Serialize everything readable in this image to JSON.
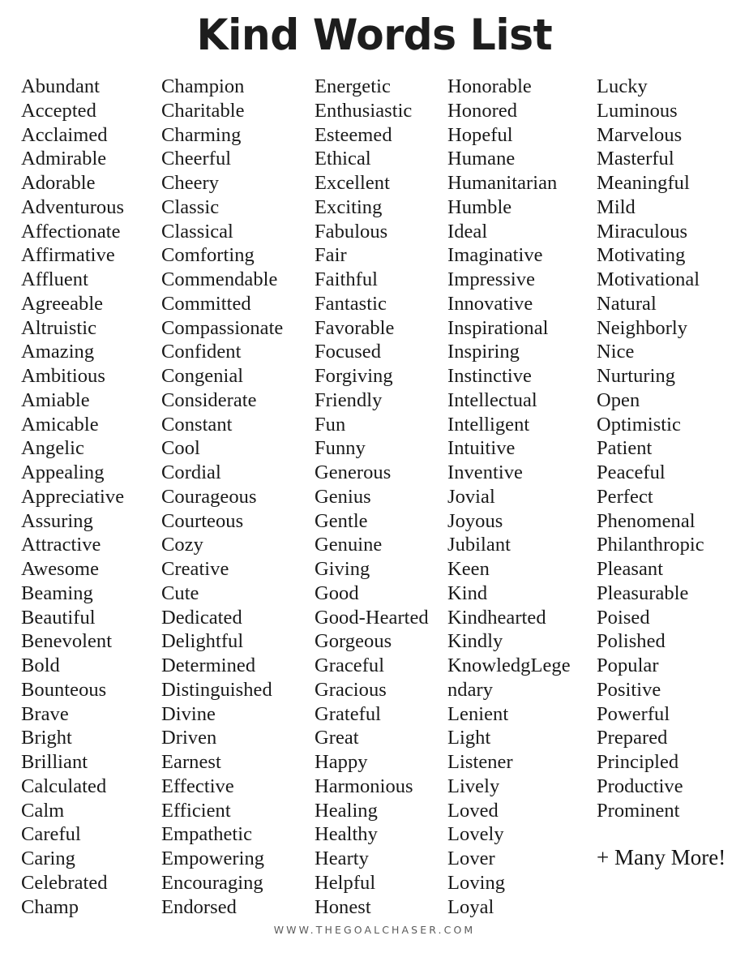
{
  "document": {
    "title": "Kind Words List",
    "background_color": "#ffffff",
    "text_color": "#1a1a1a",
    "title_color": "#1d1d1d",
    "footer_color": "#5b5b5b"
  },
  "columns": [
    {
      "index": 1,
      "words": [
        "Abundant",
        "Accepted",
        "Acclaimed",
        "Admirable",
        "Adorable",
        "Adventurous",
        "Affectionate",
        "Affirmative",
        "Affluent",
        "Agreeable",
        "Altruistic",
        "Amazing",
        "Ambitious",
        "Amiable",
        "Amicable",
        "Angelic",
        "Appealing",
        "Appreciative",
        "Assuring",
        "Attractive",
        "Awesome",
        "Beaming",
        "Beautiful",
        "Benevolent",
        "Bold",
        "Bounteous",
        "Brave",
        "Bright",
        "Brilliant",
        "Calculated",
        "Calm",
        "Careful",
        "Caring",
        "Celebrated",
        "Champ"
      ]
    },
    {
      "index": 2,
      "words": [
        "Champion",
        "Charitable",
        "Charming",
        "Cheerful",
        "Cheery",
        "Classic",
        "Classical",
        "Comforting",
        "Commendable",
        "Committed",
        "Compassionate",
        "Confident",
        "Congenial",
        "Considerate",
        "Constant",
        "Cool",
        "Cordial",
        "Courageous",
        "Courteous",
        "Cozy",
        "Creative",
        "Cute",
        "Dedicated",
        "Delightful",
        "Determined",
        "Distinguished",
        "Divine",
        "Driven",
        "Earnest",
        "Effective",
        "Efficient",
        "Empathetic",
        "Empowering",
        "Encouraging",
        "Endorsed"
      ]
    },
    {
      "index": 3,
      "words": [
        "Energetic",
        "Enthusiastic",
        "Esteemed",
        "Ethical",
        "Excellent",
        "Exciting",
        "Fabulous",
        "Fair",
        "Faithful",
        "Fantastic",
        "Favorable",
        "Focused",
        "Forgiving",
        "Friendly",
        "Fun",
        "Funny",
        "Generous",
        "Genius",
        "Gentle",
        "Genuine",
        "Giving",
        "Good",
        "Good-Hearted",
        "Gorgeous",
        "Graceful",
        "Gracious",
        "Grateful",
        "Great",
        "Happy",
        "Harmonious",
        "Healing",
        "Healthy",
        "Hearty",
        "Helpful",
        "Honest"
      ]
    },
    {
      "index": 4,
      "words": [
        "Honorable",
        "Honored",
        "Hopeful",
        "Humane",
        "Humanitarian",
        "Humble",
        "Ideal",
        "Imaginative",
        "Impressive",
        "Innovative",
        "Inspirational",
        "Inspiring",
        "Instinctive",
        "Intellectual",
        "Intelligent",
        "Intuitive",
        "Inventive",
        "Jovial",
        "Joyous",
        "Jubilant",
        "Keen",
        "Kind",
        "Kindhearted",
        "Kindly",
        "KnowledgLege",
        "ndary",
        "Lenient",
        "Light",
        "Listener",
        "Lively",
        "Loved",
        "Lovely",
        "Lover",
        "Loving",
        "Loyal"
      ]
    },
    {
      "index": 5,
      "words": [
        "Lucky",
        "Luminous",
        "Marvelous",
        "Masterful",
        "Meaningful",
        "Mild",
        "Miraculous",
        "Motivating",
        "Motivational",
        "Natural",
        "Neighborly",
        "Nice",
        "Nurturing",
        "Open",
        "Optimistic",
        "Patient",
        "Peaceful",
        "Perfect",
        "Phenomenal",
        "Philanthropic",
        "Pleasant",
        "Pleasurable",
        "Poised",
        "Polished",
        "Popular",
        "Positive",
        "Powerful",
        "Prepared",
        "Principled",
        "Productive",
        "Prominent"
      ],
      "trailing_note": "+ Many More!"
    }
  ],
  "footer": {
    "url": "WWW.THEGOALCHASER.COM"
  }
}
